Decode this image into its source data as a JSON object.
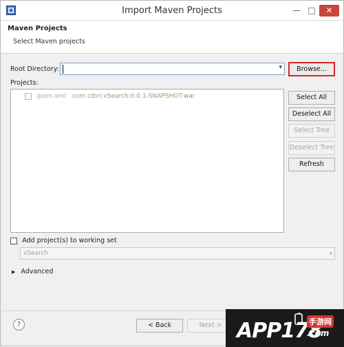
{
  "window": {
    "title": "Import Maven Projects",
    "close_symbol": "✕",
    "minimize_symbol": "—",
    "maximize_symbol": "□"
  },
  "header": {
    "title": "Maven Projects",
    "subtitle": "Select Maven projects"
  },
  "root_directory": {
    "label": "Root Directory:",
    "value": "",
    "browse_label": "Browse..."
  },
  "projects": {
    "label": "Projects:",
    "items": [
      {
        "path": "/pom.xml",
        "artifact": "com.ctbri:vSearch:0.0.1-SNAPSHOT:war",
        "checked": false
      }
    ]
  },
  "buttons": {
    "select_all": "Select All",
    "deselect_all": "Deselect All",
    "select_tree": "Select Tree",
    "deselect_tree": "Deselect Tree",
    "refresh": "Refresh"
  },
  "working_set": {
    "label": "Add project(s) to working set",
    "checked": false,
    "value": "vSearch"
  },
  "advanced": {
    "label": "Advanced"
  },
  "footer": {
    "help": "?",
    "back": "< Back",
    "next": "Next >"
  },
  "watermark": {
    "text": "APP178",
    "sub": "手游网",
    "domain": ".com"
  },
  "colors": {
    "accent_red": "#d4262b",
    "focus_blue": "#7ea0c9",
    "artifact_olive": "#9b9b68"
  }
}
